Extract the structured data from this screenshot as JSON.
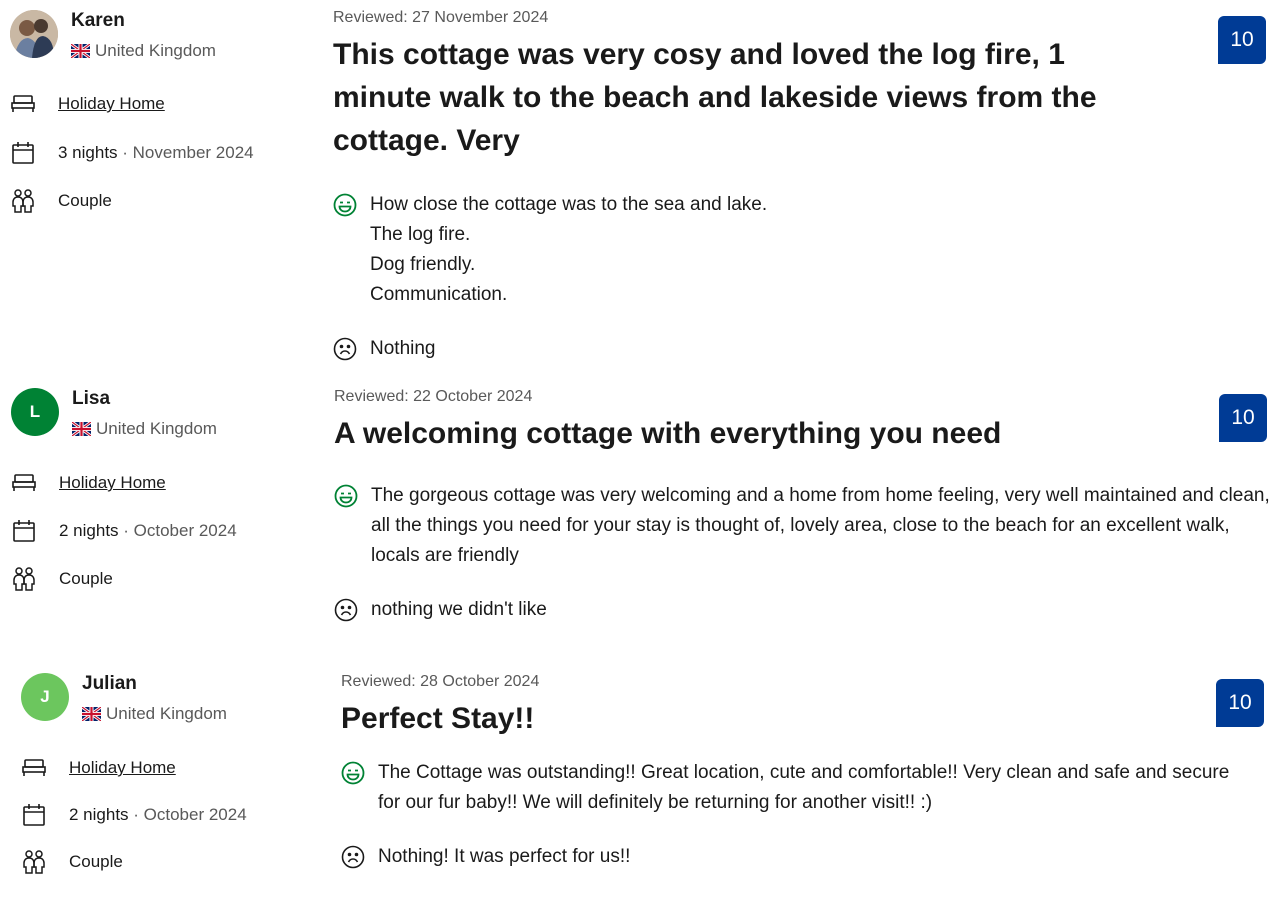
{
  "reviews": [
    {
      "name": "Karen",
      "avatar_type": "photo",
      "country": "United Kingdom",
      "room": "Holiday Home",
      "nights": "3 nights",
      "month": "November 2024",
      "group": "Couple",
      "date": "Reviewed: 27 November 2024",
      "title": "This cottage was very cosy and loved the log fire, 1 minute walk to the beach and lakeside views from the cottage. Very",
      "pros": [
        "How close the cottage was to the sea and lake.",
        "The log fire.",
        "Dog friendly.",
        "Communication."
      ],
      "con": "Nothing",
      "score": "10"
    },
    {
      "name": "Lisa",
      "avatar_initial": "L",
      "avatar_color": "#008234",
      "country": "United Kingdom",
      "room": "Holiday Home",
      "nights": "2 nights",
      "month": "October 2024",
      "group": "Couple",
      "date": "Reviewed: 22 October 2024",
      "title": "A welcoming cottage with everything you need",
      "pros": [
        "The gorgeous cottage was very welcoming and a home from home feeling, very well maintained and clean, all the things you need for your stay is thought of, lovely area, close to the beach for an excellent walk, locals are friendly"
      ],
      "con": "nothing we didn't like",
      "score": "10"
    },
    {
      "name": "Julian",
      "avatar_initial": "J",
      "avatar_color": "#6cc65e",
      "country": "United Kingdom",
      "room": "Holiday Home",
      "nights": "2 nights",
      "month": "October 2024",
      "group": "Couple",
      "date": "Reviewed: 28 October 2024",
      "title": "Perfect Stay!!",
      "pros": [
        "The Cottage was outstanding!! Great location, cute and comfortable!! Very clean and safe and secure for our fur baby!! We will definitely be returning for another visit!! :)"
      ],
      "con": "Nothing! It was perfect for us!!",
      "score": "10"
    }
  ],
  "colors": {
    "score_bg": "#003b95",
    "positive": "#008234",
    "muted": "#595959"
  },
  "icons": {
    "room": "bed-icon",
    "stay": "calendar-icon",
    "group": "people-icon",
    "positive": "smile-icon",
    "negative": "frown-icon"
  }
}
